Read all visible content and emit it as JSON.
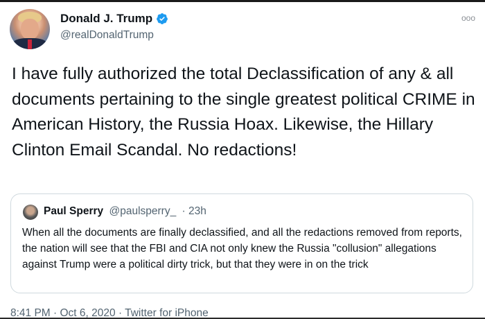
{
  "tweet": {
    "display_name": "Donald J. Trump",
    "handle": "@realDonaldTrump",
    "more_menu": "ooo",
    "text": "I have fully authorized the total Declassification of any & all documents pertaining to the single greatest political CRIME in American History, the Russia Hoax. Likewise, the Hillary Clinton Email Scandal. No redactions!",
    "verified_icon": "verified-badge-icon"
  },
  "quoted_tweet": {
    "display_name": "Paul Sperry",
    "handle": "@paulsperry_",
    "time": "· 23h",
    "text": "When all the documents are finally declassified, and all the redactions removed from reports, the nation will see that the FBI and CIA not only knew the Russia \"collusion\" allegations against Trump were a political dirty trick, but that they were in on the trick"
  },
  "footer": {
    "timestamp": "8:41 PM · Oct 6, 2020 · Twitter for iPhone"
  },
  "colors": {
    "verified_blue": "#1d9bf0",
    "secondary_text": "#536471",
    "border": "#cfd9de"
  }
}
